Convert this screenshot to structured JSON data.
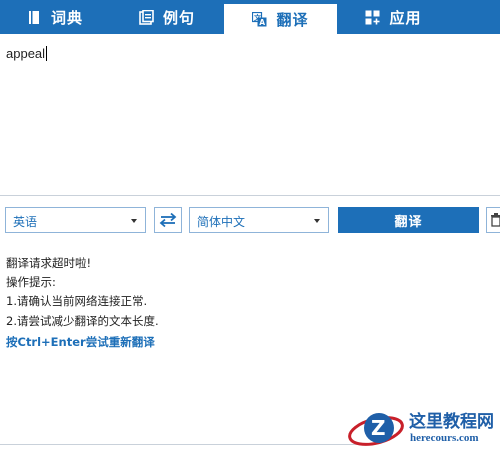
{
  "tabs": [
    {
      "label": "词典",
      "icon": "book-icon",
      "active": false
    },
    {
      "label": "例句",
      "icon": "sentences-icon",
      "active": false
    },
    {
      "label": "翻译",
      "icon": "translate-icon",
      "active": true
    },
    {
      "label": "应用",
      "icon": "apps-icon",
      "active": false
    }
  ],
  "source": {
    "text": "appeal"
  },
  "controls": {
    "source_lang": "英语",
    "target_lang": "简体中文",
    "translate_label": "翻译",
    "swap_icon": "swap-arrows-icon",
    "clear_icon": "trash-icon"
  },
  "result": {
    "error_title": "翻译请求超时啦!",
    "tips_heading": "操作提示:",
    "tip1": "1.请确认当前网络连接正常.",
    "tip2": "2.请尝试减少翻译的文本长度.",
    "retry_hint": "按Ctrl+Enter尝试重新翻译"
  },
  "watermark": {
    "title": "这里教程网",
    "url": "herecours.com"
  },
  "colors": {
    "accent": "#1d6fb8",
    "border": "#8fb4d9",
    "text": "#222222"
  }
}
